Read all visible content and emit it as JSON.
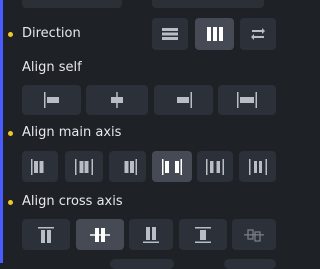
{
  "sections": {
    "direction": {
      "label": "Direction",
      "marked": true,
      "selected": "column"
    },
    "align_self": {
      "label": "Align self",
      "marked": false
    },
    "align_main_axis": {
      "label": "Align main axis",
      "marked": true,
      "selected": "center"
    },
    "align_cross_axis": {
      "label": "Align cross axis",
      "marked": true,
      "selected": "center"
    }
  },
  "colors": {
    "background": "#1e2126",
    "button": "#2c3038",
    "button_active": "#454a54",
    "marker_dot": "#f2c62a",
    "accent_line": "#4a5cff"
  },
  "icons": {
    "direction": [
      "row-icon",
      "column-icon",
      "reverse-icon"
    ],
    "align_self": [
      "align-self-start-icon",
      "align-self-center-icon",
      "align-self-end-icon",
      "align-self-stretch-icon"
    ],
    "align_main_axis": [
      "main-start-icon",
      "main-center-icon",
      "main-end-icon",
      "main-space-between-icon",
      "main-space-around-icon",
      "main-space-evenly-icon"
    ],
    "align_cross_axis": [
      "cross-start-icon",
      "cross-center-icon",
      "cross-end-icon",
      "cross-stretch-icon",
      "cross-baseline-icon"
    ]
  }
}
